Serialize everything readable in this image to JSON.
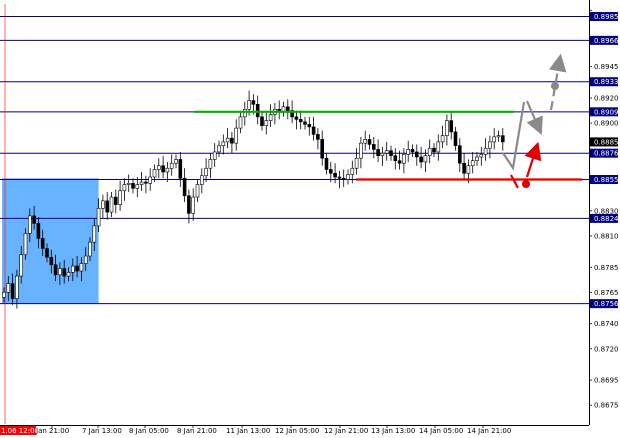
{
  "chart_data": {
    "type": "candlestick",
    "title": "",
    "xlabel": "",
    "ylabel": "",
    "ylim": [
      0.866,
      0.8995
    ],
    "y_ticks": [
      0.8675,
      0.8695,
      0.872,
      0.874,
      0.8765,
      0.8785,
      0.881,
      0.883,
      0.8855,
      0.8875,
      0.89,
      0.892,
      0.8945,
      0.8965,
      0.899
    ],
    "x_tick_labels": [
      "1.06 12:00",
      "Jan 21:00",
      "7 Jan 13:00",
      "8 Jan 05:00",
      "8 Jan 21:00",
      "11 Jan 13:00",
      "12 Jan 05:00",
      "12 Jan 21:00",
      "13 Jan 13:00",
      "14 Jan 05:00",
      "14 Jan 21:00"
    ],
    "level_labels": [
      "0.8985",
      "0.8966",
      "0.8933",
      "0.8909",
      "0.8885",
      "0.8876",
      "0.8855",
      "0.8824",
      "0.8756"
    ],
    "close_prices": [
      0.8765,
      0.8772,
      0.876,
      0.8778,
      0.8795,
      0.8812,
      0.8826,
      0.882,
      0.8808,
      0.88,
      0.8793,
      0.8787,
      0.8779,
      0.8784,
      0.8778,
      0.8781,
      0.8786,
      0.8782,
      0.8788,
      0.8794,
      0.8805,
      0.8818,
      0.8832,
      0.8838,
      0.8829,
      0.8841,
      0.8835,
      0.8846,
      0.8851,
      0.8852,
      0.8848,
      0.8851,
      0.8853,
      0.8852,
      0.8857,
      0.8863,
      0.8866,
      0.8861,
      0.8864,
      0.8868,
      0.8871,
      0.8856,
      0.8842,
      0.8828,
      0.8841,
      0.8851,
      0.8858,
      0.8864,
      0.8871,
      0.8877,
      0.8882,
      0.8885,
      0.8888,
      0.8884,
      0.8896,
      0.8905,
      0.8911,
      0.8918,
      0.8915,
      0.8905,
      0.8898,
      0.8902,
      0.8907,
      0.8911,
      0.8909,
      0.8913,
      0.891,
      0.8905,
      0.8903,
      0.8901,
      0.8899,
      0.8897,
      0.8891,
      0.8887,
      0.8872,
      0.8863,
      0.886,
      0.8857,
      0.8856,
      0.8855,
      0.8859,
      0.8864,
      0.8872,
      0.8884,
      0.8887,
      0.8883,
      0.8879,
      0.8874,
      0.8876,
      0.8878,
      0.8874,
      0.887,
      0.8868,
      0.8875,
      0.8879,
      0.8877,
      0.8873,
      0.8869,
      0.8874,
      0.888,
      0.8877,
      0.8885,
      0.889,
      0.8902,
      0.8893,
      0.8882,
      0.8868,
      0.886,
      0.8866,
      0.887,
      0.8873,
      0.8875,
      0.888,
      0.8885,
      0.8889,
      0.889,
      0.8885
    ],
    "volume_note": "",
    "colors": {
      "level_line": "#000080",
      "resistance": "#00b000",
      "support": "#e00000",
      "zone": "#4da6ff",
      "scenario_grey": "#8a8a8a",
      "scenario_red": "#e00000",
      "marker_line": "#ff0000"
    },
    "levels": [
      {
        "value": 0.8985,
        "label": "0.8985"
      },
      {
        "value": 0.8966,
        "label": "0.8966"
      },
      {
        "value": 0.8933,
        "label": "0.8933"
      },
      {
        "value": 0.8909,
        "label": "0.8909"
      },
      {
        "value": 0.8876,
        "label": "0.8876"
      },
      {
        "value": 0.8855,
        "label": "0.8855"
      },
      {
        "value": 0.8824,
        "label": "0.8824"
      },
      {
        "value": 0.8756,
        "label": "0.8756"
      }
    ],
    "current_price": {
      "value": 0.8885,
      "label": "0.8885"
    },
    "resistance_level": 0.8909,
    "support_level": 0.8855,
    "zone": {
      "from_bar": 0,
      "to_bar": 22,
      "y_high": 0.8856,
      "y_low": 0.8756
    }
  }
}
